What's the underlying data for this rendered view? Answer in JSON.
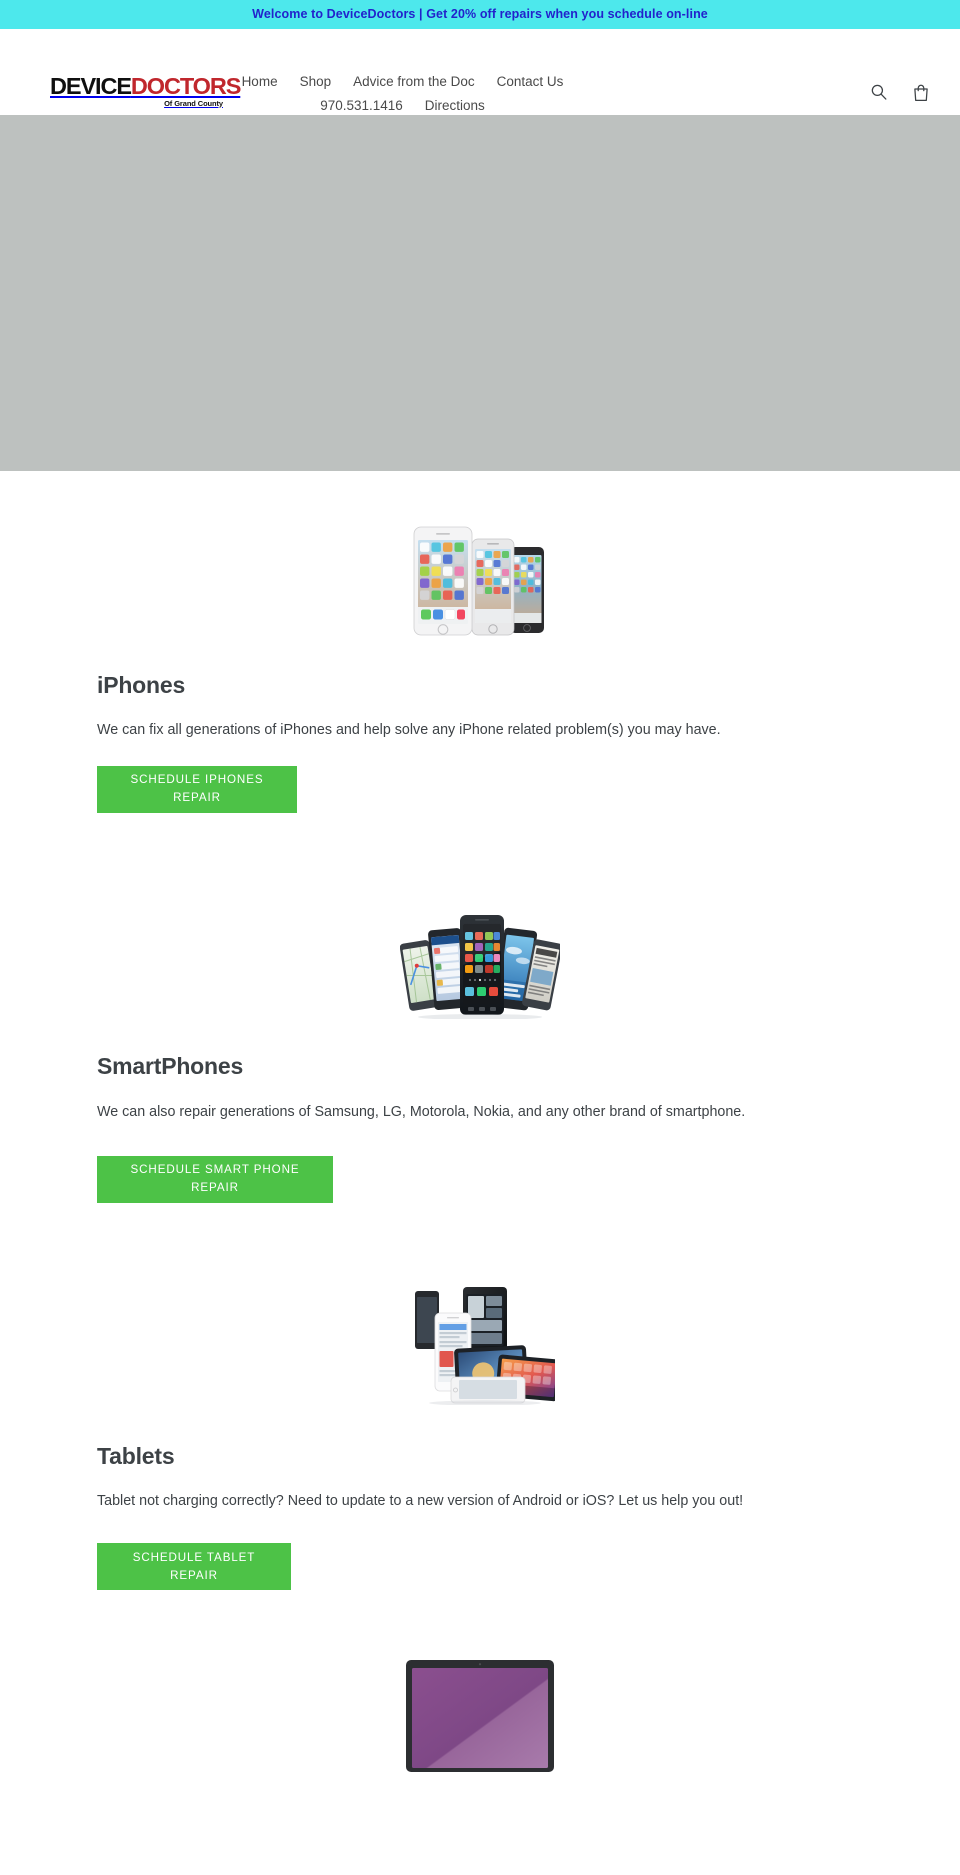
{
  "announcement": {
    "text": "Welcome to DeviceDoctors | Get 20% off repairs when you schedule on-line",
    "bg_color": "#4de8ec",
    "text_color": "#2222cc"
  },
  "header": {
    "logo": {
      "part1": "DEVICE",
      "part2": "DOCTORS",
      "subtitle": "Of Grand County",
      "part1_color": "#101010",
      "part2_color": "#c0272d"
    },
    "nav": [
      {
        "label": "Home"
      },
      {
        "label": "Shop"
      },
      {
        "label": "Advice from the Doc"
      },
      {
        "label": "Contact Us"
      },
      {
        "label": "970.531.1416"
      },
      {
        "label": "Directions"
      }
    ],
    "icons": [
      {
        "name": "search-icon",
        "label": "Search"
      },
      {
        "name": "cart-icon",
        "label": "Cart"
      }
    ]
  },
  "hero": {
    "bg_color": "#bdc1bf"
  },
  "sections": [
    {
      "id": "iphones",
      "image_name": "iphones-product-image",
      "title": "iPhones",
      "text": "We can fix all generations of iPhones and help solve any iPhone related problem(s) you may have.",
      "button_label": "Schedule iPhones Repair",
      "button_color": "#4dc247"
    },
    {
      "id": "smartphones",
      "image_name": "smartphones-product-image",
      "title": "SmartPhones",
      "text": "We can also repair generations of Samsung, LG, Motorola, Nokia, and any other brand of smartphone.",
      "button_label": "Schedule Smart Phone Repair",
      "button_color": "#4dc247"
    },
    {
      "id": "tablets",
      "image_name": "tablets-product-image",
      "title": "Tablets",
      "text": "Tablet not charging correctly? Need to update to a new version of Android or iOS? Let us help you out!",
      "button_label": "Schedule Tablet Repair",
      "button_color": "#4dc247"
    },
    {
      "id": "laptops",
      "image_name": "laptop-product-image",
      "title": "",
      "text": "",
      "button_label": "",
      "button_color": "#4dc247"
    }
  ]
}
